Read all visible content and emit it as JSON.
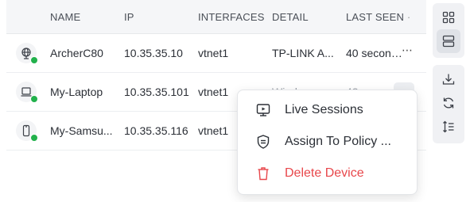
{
  "table": {
    "columns": [
      "NAME",
      "IP",
      "INTERFACES",
      "DETAIL",
      "LAST SEEN"
    ],
    "sort_indicator": "·",
    "rows": [
      {
        "icon": "globe-device-icon",
        "name": "ArcherC80",
        "ip": "10.35.35.10",
        "interface": "vtnet1",
        "detail": "TP-LINK A...",
        "last_seen": "40 second...",
        "online": true
      },
      {
        "icon": "laptop-icon",
        "name": "My-Laptop",
        "ip": "10.35.35.101",
        "interface": "vtnet1",
        "detail": "Windows ...",
        "last_seen": "42 secon...",
        "online": true
      },
      {
        "icon": "phone-icon",
        "name": "My-Samsu...",
        "ip": "10.35.35.116",
        "interface": "vtnet1",
        "detail": "",
        "last_seen": "",
        "online": true
      }
    ],
    "row_more_label": "⋯"
  },
  "context_menu": {
    "items": [
      {
        "label": "Live Sessions",
        "icon": "monitor-play-icon"
      },
      {
        "label": "Assign To Policy ...",
        "icon": "shield-icon"
      },
      {
        "label": "Delete Device",
        "icon": "trash-icon",
        "danger": true
      }
    ]
  },
  "toolbar": {
    "view_buttons": [
      "grid-view-icon",
      "list-view-icon"
    ],
    "action_buttons": [
      "download-icon",
      "refresh-icon",
      "sort-icon"
    ]
  },
  "colors": {
    "online": "#22b14c",
    "danger": "#e8474b",
    "header_bg": "#f5f6f8"
  }
}
